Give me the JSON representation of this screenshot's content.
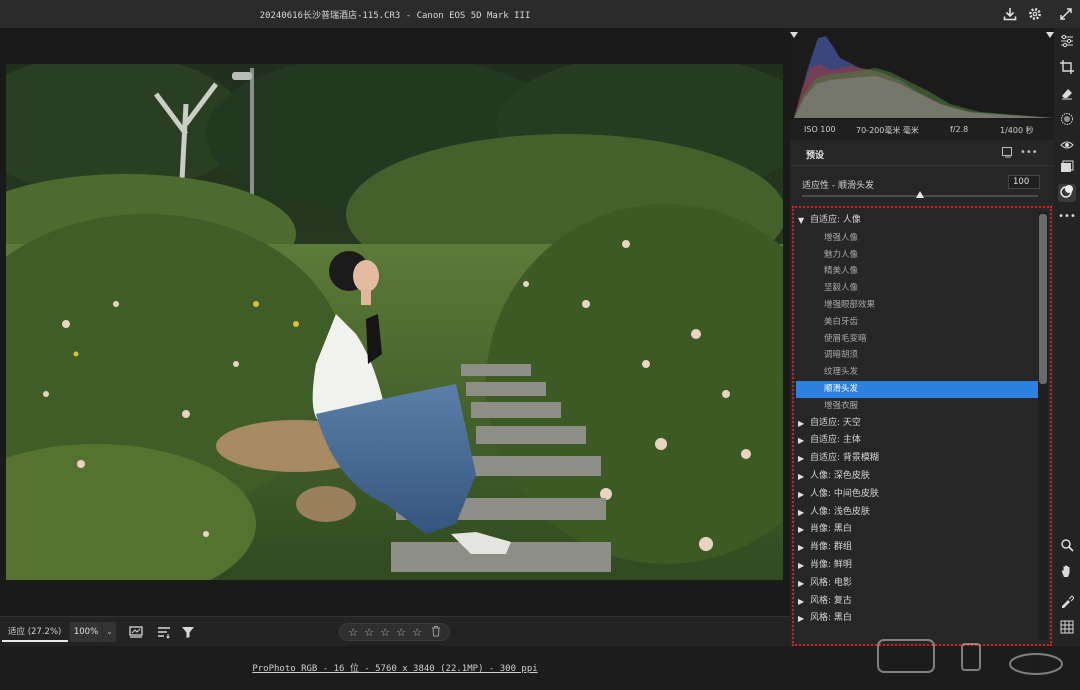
{
  "window": {
    "title": "20240616长沙普瑞酒店-115.CR3 -  Canon EOS 5D Mark III"
  },
  "titlebar_icons": [
    "download-icon",
    "gear-icon",
    "expand-icon"
  ],
  "histogram": {
    "iso": "ISO 100",
    "lens": "70-200毫米 毫米",
    "aperture": "f/2.8",
    "shutter": "1/400 秒"
  },
  "presets": {
    "title": "预设",
    "amount_label": "适应性 - 顺滑头发",
    "amount_value": "100",
    "amount_fraction": 0.5,
    "groups": [
      {
        "label": "自适应: 人像",
        "expanded": true,
        "items": [
          {
            "label": "增强人像",
            "selected": false
          },
          {
            "label": "魅力人像",
            "selected": false
          },
          {
            "label": "精美人像",
            "selected": false
          },
          {
            "label": "坚毅人像",
            "selected": false
          },
          {
            "label": "增强眼部效果",
            "selected": false
          },
          {
            "label": "美白牙齿",
            "selected": false
          },
          {
            "label": "使眉毛变暗",
            "selected": false
          },
          {
            "label": "调暗胡须",
            "selected": false
          },
          {
            "label": "纹理头发",
            "selected": false
          },
          {
            "label": "顺滑头发",
            "selected": true
          },
          {
            "label": "增强衣服",
            "selected": false
          }
        ]
      },
      {
        "label": "自适应: 天空",
        "expanded": false,
        "items": []
      },
      {
        "label": "自适应: 主体",
        "expanded": false,
        "items": []
      },
      {
        "label": "自适应: 背景模糊",
        "expanded": false,
        "items": []
      },
      {
        "label": "人像: 深色皮肤",
        "expanded": false,
        "items": []
      },
      {
        "label": "人像: 中间色皮肤",
        "expanded": false,
        "items": []
      },
      {
        "label": "人像: 浅色皮肤",
        "expanded": false,
        "items": []
      },
      {
        "label": "肖像: 黑白",
        "expanded": false,
        "items": []
      },
      {
        "label": "肖像: 群组",
        "expanded": false,
        "items": []
      },
      {
        "label": "肖像: 鲜明",
        "expanded": false,
        "items": []
      },
      {
        "label": "风格: 电影",
        "expanded": false,
        "items": []
      },
      {
        "label": "风格: 复古",
        "expanded": false,
        "items": []
      },
      {
        "label": "风格: 黑白",
        "expanded": false,
        "items": []
      }
    ]
  },
  "statusbar": {
    "fit_label": "适应 (27.2%)",
    "zoom_value": "100%",
    "rating_stars": 5
  },
  "footer": {
    "file_info": "ProPhoto RGB - 16 位 - 5760 x 3840 (22.1MP) - 300 ppi"
  },
  "toolstrip": [
    "edit-sliders-icon",
    "crop-icon",
    "eraser-icon",
    "masking-icon",
    "redeye-icon",
    "presets-icon",
    "snapshots-icon",
    "more-icon",
    "zoom-icon",
    "hand-icon",
    "sampler-icon",
    "grid-icon"
  ],
  "colors": {
    "selection": "#2d7fe0",
    "annotation_border": "#d42020",
    "panel_bg": "#262626"
  }
}
